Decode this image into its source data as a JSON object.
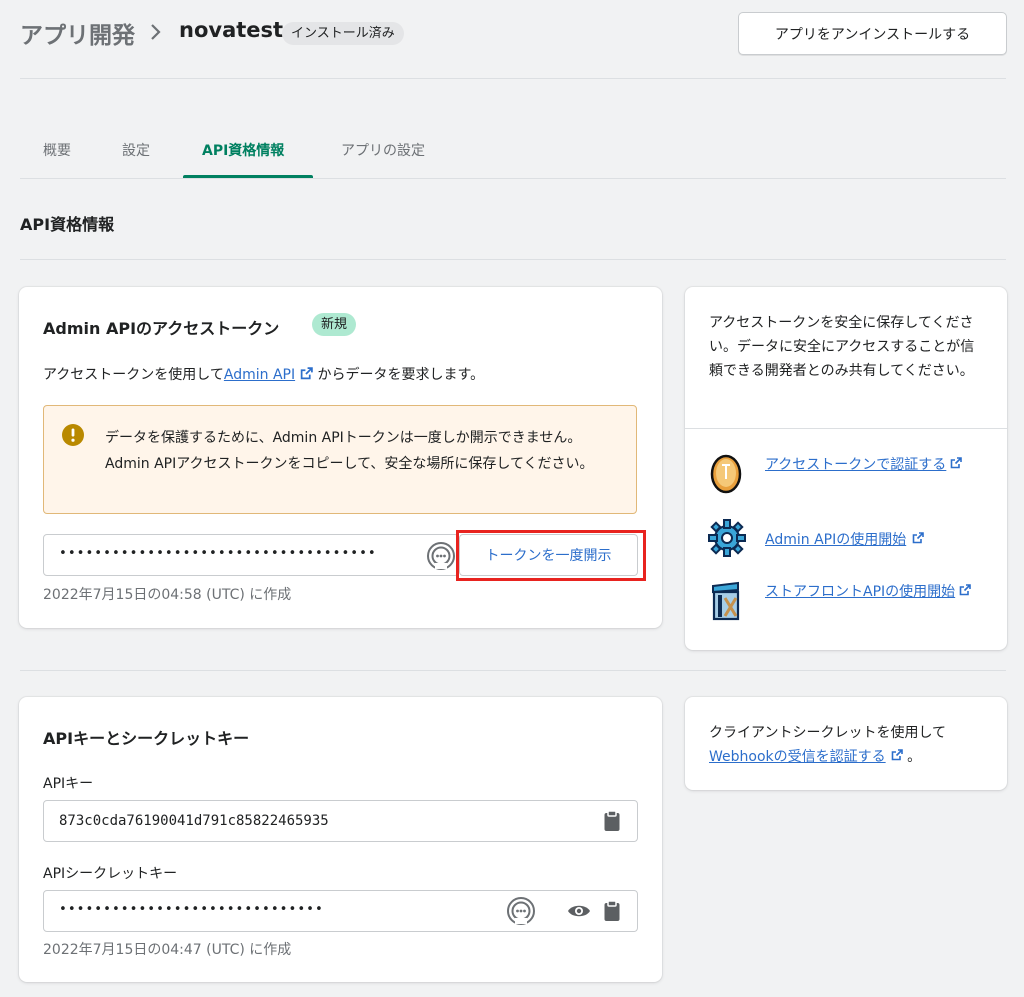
{
  "header": {
    "breadcrumb_parent": "アプリ開発",
    "app_name": "novatest",
    "status_badge": "インストール済み",
    "uninstall_label": "アプリをアンインストールする"
  },
  "tabs": [
    {
      "label": "概要"
    },
    {
      "label": "設定"
    },
    {
      "label": "API資格情報",
      "active": true
    },
    {
      "label": "アプリの設定"
    }
  ],
  "section_title": "API資格情報",
  "admin_token_card": {
    "title": "Admin APIのアクセストークン",
    "badge": "新規",
    "desc_before": "アクセストークンを使用して",
    "desc_link": "Admin API",
    "desc_after": " からデータを要求します。",
    "warning_text": "データを保護するために、Admin APIトークンは一度しか開示できません。Admin APIアクセストークンをコピーして、安全な場所に保存してください。",
    "token_masked": "••••••••••••••••••••••••••••••••••••",
    "reveal_label": "トークンを一度開示",
    "created": "2022年7月15日の04:58 (UTC) に作成"
  },
  "side_card_1": {
    "text": "アクセストークンを安全に保存してください。データに安全にアクセスすることが信頼できる開発者とのみ共有してください。",
    "links": [
      {
        "label": "アクセストークンで認証する",
        "icon": "coin-icon"
      },
      {
        "label": "Admin APIの使用開始",
        "icon": "gear-icon"
      },
      {
        "label": "ストアフロントAPIの使用開始",
        "icon": "storefront-icon"
      }
    ]
  },
  "api_key_card": {
    "title": "APIキーとシークレットキー",
    "api_key_label": "APIキー",
    "api_key_value": "873c0cda76190041d791c85822465935",
    "secret_label": "APIシークレットキー",
    "secret_masked": "••••••••••••••••••••••••••••••",
    "created": "2022年7月15日の04:47 (UTC) に作成"
  },
  "side_card_2": {
    "text_before": "クライアントシークレットを使用して",
    "link": "Webhookの受信を認証する",
    "text_after": " 。"
  },
  "colors": {
    "accent_green": "#008060",
    "link_blue": "#2c6ecb",
    "highlight_red": "#e8231f",
    "warning_bg": "#fff5ea"
  }
}
